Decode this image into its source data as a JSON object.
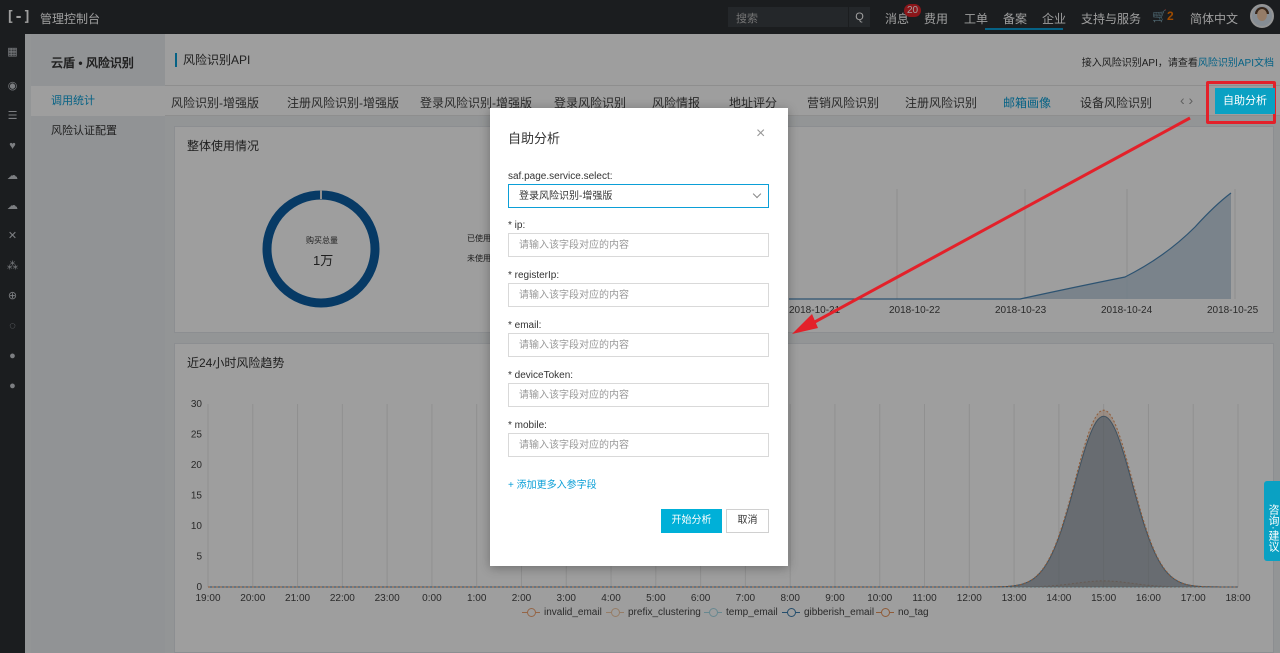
{
  "topbar": {
    "logo": "[-]",
    "title": "管理控制台",
    "search_placeholder": "搜索",
    "search_btn": "Q",
    "nav": [
      "消息",
      "费用",
      "工单",
      "备案",
      "企业",
      "支持与服务"
    ],
    "messages_badge": "20",
    "cart_icon": "🛒",
    "cart_count": "2",
    "language": "简体中文"
  },
  "sidebar": {
    "title": "云盾 • 风险识别",
    "items": [
      "调用统计",
      "风险认证配置"
    ],
    "active_index": 0
  },
  "header": {
    "page_title": "风险识别API",
    "doc_hint_prefix": "接入风险识别API，请查看",
    "doc_link": "风险识别API文档"
  },
  "tabs": {
    "items": [
      "风险识别-增强版",
      "注册风险识别-增强版",
      "登录风险识别-增强版",
      "登录风险识别",
      "风险情报",
      "地址评分",
      "营销风险识别",
      "注册风险识别",
      "邮箱画像",
      "设备风险识别"
    ],
    "active": "邮箱画像",
    "arrows": "‹ ›",
    "auto_button": "自助分析"
  },
  "usage_card": {
    "title": "整体使用情况",
    "donut_label": "购买总量",
    "donut_value": "1万",
    "used_label": "已使用",
    "unused_label": "未使用",
    "x_dates": [
      "2018-10-21",
      "2018-10-22",
      "2018-10-23",
      "2018-10-24",
      "2018-10-25"
    ]
  },
  "trend_card": {
    "title": "近24小时风险趋势"
  },
  "chart_data": {
    "type": "area",
    "title": "近24小时风险趋势",
    "x": [
      "19:00",
      "20:00",
      "21:00",
      "22:00",
      "23:00",
      "0:00",
      "1:00",
      "2:00",
      "3:00",
      "4:00",
      "5:00",
      "6:00",
      "7:00",
      "8:00",
      "9:00",
      "10:00",
      "11:00",
      "12:00",
      "13:00",
      "14:00",
      "15:00",
      "16:00",
      "17:00",
      "18:00"
    ],
    "y_ticks": [
      0,
      5,
      10,
      15,
      20,
      25,
      30
    ],
    "ylim": [
      0,
      30
    ],
    "series": [
      {
        "name": "invalid_email",
        "color": "#f0a471",
        "peak": 1
      },
      {
        "name": "prefix_clustering",
        "color": "#f3c9a3",
        "peak": 0
      },
      {
        "name": "temp_email",
        "color": "#a6dbe8",
        "peak": 0
      },
      {
        "name": "gibberish_email",
        "color": "#3c7fb0",
        "peak": 28
      },
      {
        "name": "no_tag",
        "color": "#e8935a",
        "peak": 29
      }
    ],
    "grid": "vertical",
    "legend": "bottom"
  },
  "modal": {
    "title": "自助分析",
    "close": "×",
    "select_label": "saf.page.service.select:",
    "select_value": "登录风险识别-增强版",
    "fields": [
      {
        "label": "* ip:",
        "placeholder": "请输入该字段对应的内容"
      },
      {
        "label": "* registerIp:",
        "placeholder": "请输入该字段对应的内容"
      },
      {
        "label": "* email:",
        "placeholder": "请输入该字段对应的内容"
      },
      {
        "label": "* deviceToken:",
        "placeholder": "请输入该字段对应的内容"
      },
      {
        "label": "* mobile:",
        "placeholder": "请输入该字段对应的内容"
      }
    ],
    "add_link": "+ 添加更多入参字段",
    "start_button": "开始分析",
    "cancel_button": "取消"
  },
  "consult": "咨询·建议",
  "colors": {
    "accent": "#0b9fd7",
    "annotation": "#e3212a"
  }
}
